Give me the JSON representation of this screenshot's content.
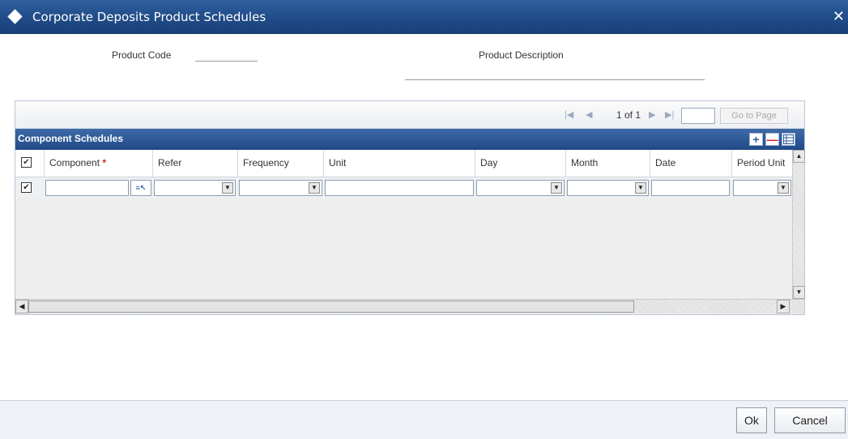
{
  "window": {
    "title": "Corporate Deposits Product Schedules",
    "close_label": "✕"
  },
  "product": {
    "code_label": "Product Code",
    "code_value": "",
    "description_label": "Product Description",
    "description_value": ""
  },
  "pager": {
    "page_info": "1 of 1",
    "page_input": "",
    "goto_label": "Go to Page"
  },
  "grid": {
    "title": "Component Schedules",
    "add_label": "+",
    "delete_label": "—",
    "columns": [
      {
        "label": "Component",
        "required": true
      },
      {
        "label": "Refer"
      },
      {
        "label": "Frequency"
      },
      {
        "label": "Unit"
      },
      {
        "label": "Day"
      },
      {
        "label": "Month"
      },
      {
        "label": "Date"
      },
      {
        "label": "Period Unit"
      }
    ],
    "rows": [
      {
        "checked": true,
        "component": "",
        "refer": "",
        "frequency": "",
        "unit": "",
        "day": "",
        "month": "",
        "date": "",
        "period_unit": ""
      }
    ],
    "header_checked": true
  },
  "footer": {
    "ok_label": "Ok",
    "cancel_label": "Cancel"
  },
  "colors": {
    "titlebar": "#1f4a86",
    "grid_header": "#1f4a86",
    "required_marker": "#e02020"
  }
}
